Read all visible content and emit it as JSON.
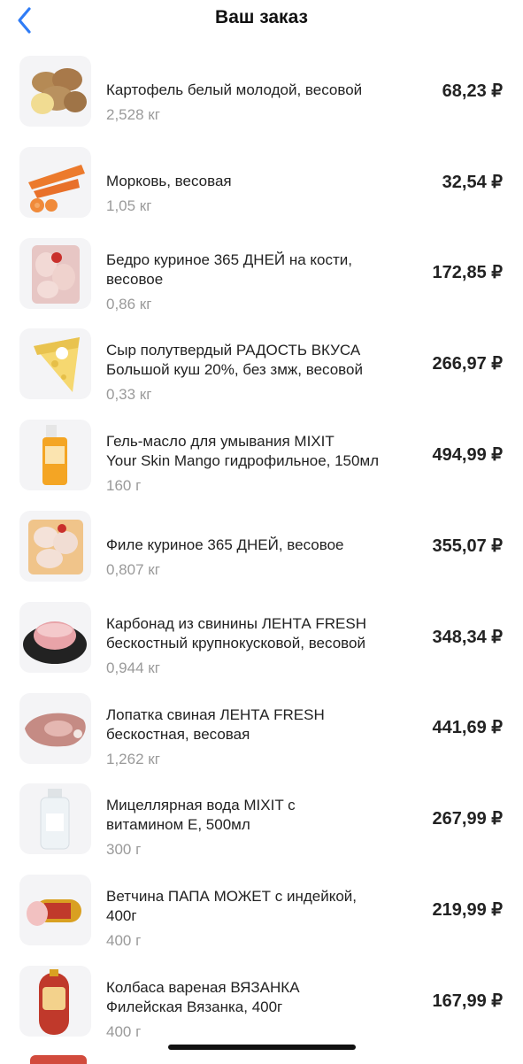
{
  "header": {
    "title": "Ваш заказ",
    "back_icon": "chevron-left-icon",
    "accent": "#2f7cf6"
  },
  "items": [
    {
      "name": [
        "Картофель белый молодой, весовой"
      ],
      "qty": "2,528 кг",
      "price": "68,23 ₽",
      "thumb": "potato"
    },
    {
      "name": [
        "Морковь, весовая"
      ],
      "qty": "1,05 кг",
      "price": "32,54 ₽",
      "thumb": "carrot"
    },
    {
      "name": [
        "Бедро куриное 365 ДНЕЙ на кости,",
        "весовое"
      ],
      "qty": "0,86 кг",
      "price": "172,85 ₽",
      "thumb": "chicken-tray"
    },
    {
      "name": [
        "Сыр полутвердый РАДОСТЬ ВКУСА",
        "Большой куш 20%, без змж, весовой"
      ],
      "qty": "0,33 кг",
      "price": "266,97 ₽",
      "thumb": "cheese"
    },
    {
      "name": [
        "Гель-масло для умывания MIXIT",
        "Your Skin Mango гидрофильное, 150мл"
      ],
      "qty": "160 г",
      "price": "494,99 ₽",
      "thumb": "bottle-orange"
    },
    {
      "name": [
        "Филе куриное 365 ДНЕЙ, весовое"
      ],
      "qty": "0,807 кг",
      "price": "355,07 ₽",
      "thumb": "fillet-tray"
    },
    {
      "name": [
        "Карбонад из свинины ЛЕНТА FRESH",
        "бескостный крупнокусковой, весовой"
      ],
      "qty": "0,944 кг",
      "price": "348,34 ₽",
      "thumb": "pork-plate"
    },
    {
      "name": [
        "Лопатка свиная ЛЕНТА FRESH",
        "бескостная, весовая"
      ],
      "qty": "1,262 кг",
      "price": "441,69 ₽",
      "thumb": "pork-shoulder"
    },
    {
      "name": [
        "Мицеллярная вода MIXIT с",
        "витамином Е, 500мл"
      ],
      "qty": "300 г",
      "price": "267,99 ₽",
      "thumb": "bottle-clear"
    },
    {
      "name": [
        "Ветчина ПАПА МОЖЕТ с индейкой,",
        "400г"
      ],
      "qty": "400 г",
      "price": "219,99 ₽",
      "thumb": "ham"
    },
    {
      "name": [
        "Колбаса вареная ВЯЗАНКА",
        "Филейская Вязанка, 400г"
      ],
      "qty": "400 г",
      "price": "167,99 ₽",
      "thumb": "sausage"
    }
  ]
}
